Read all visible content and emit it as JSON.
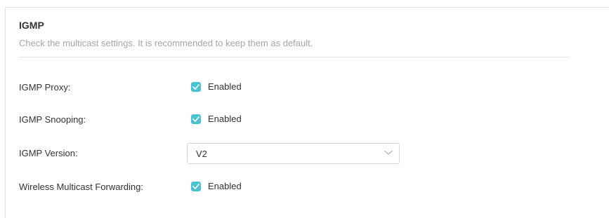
{
  "section": {
    "title": "IGMP",
    "description": "Check the multicast settings. It is recommended to keep them as default."
  },
  "fields": {
    "igmp_proxy": {
      "label": "IGMP Proxy:",
      "checkbox_label": "Enabled",
      "checked": true
    },
    "igmp_snooping": {
      "label": "IGMP Snooping:",
      "checkbox_label": "Enabled",
      "checked": true
    },
    "igmp_version": {
      "label": "IGMP Version:",
      "value": "V2"
    },
    "wireless_multicast_forwarding": {
      "label": "Wireless Multicast Forwarding:",
      "checkbox_label": "Enabled",
      "checked": true
    }
  },
  "colors": {
    "accent": "#4bc2d1",
    "text": "#333333",
    "muted": "#a6a6a6"
  },
  "icons": {
    "check": "check-icon",
    "dropdown": "chevron-down-icon"
  }
}
